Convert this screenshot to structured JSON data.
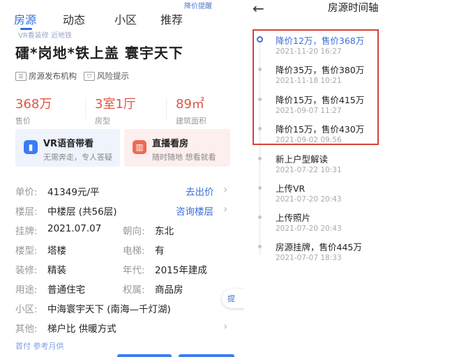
{
  "tabs": [
    "房源",
    "动态",
    "小区",
    "推荐"
  ],
  "cut_text": {
    "left": "VR看装修  近地铁",
    "right": "降价提醒"
  },
  "listing": {
    "title": "礌*岗地*铁上盖     寰宇天下"
  },
  "tags": [
    {
      "icon": "info-icon",
      "label": "房源发布机构"
    },
    {
      "icon": "shield-icon",
      "label": "风险提示"
    }
  ],
  "stats": [
    {
      "value": "368万",
      "label": "售价"
    },
    {
      "value": "3室1厅",
      "label": "房型"
    },
    {
      "value": "89㎡",
      "label": "建筑面积"
    }
  ],
  "cards": [
    {
      "icon": "vr-icon",
      "title": "VR语音带看",
      "subtitle": "无需奔走，专人答疑"
    },
    {
      "icon": "live-icon",
      "title": "直播看房",
      "subtitle": "随时随地 想看就看"
    }
  ],
  "info_rows": [
    {
      "k": "单价:",
      "v": "41349元/平",
      "link": "去出价"
    },
    {
      "k": "楼层:",
      "v": "中楼层 (共56层)",
      "link": "咨询楼层"
    },
    {
      "k": "挂牌:",
      "v": "2021.07.07",
      "k2": "朝向:",
      "v2": "东北"
    },
    {
      "k": "楼型:",
      "v": "塔楼",
      "k2": "电梯:",
      "v2": "有"
    },
    {
      "k": "装修:",
      "v": "精装",
      "k2": "年代:",
      "v2": "2015年建成"
    },
    {
      "k": "用途:",
      "v": "普通住宅",
      "k2": "权属:",
      "v2": "商品房"
    },
    {
      "k": "小区:",
      "v": "中海寰宇天下 (南海—千灯湖)"
    },
    {
      "k": "其他:",
      "v": "梯户比 供暖方式"
    }
  ],
  "float_button": "提",
  "cut_bottom": "首付 参考月供",
  "timeline": {
    "title": "房源时间轴",
    "items": [
      {
        "event": "降价12万，售价368万",
        "date": "2021-11-20 16:27",
        "active": true
      },
      {
        "event": "降价35万，售价380万",
        "date": "2021-11-18 10:21"
      },
      {
        "event": "降价15万，售价415万",
        "date": "2021-09-07 11:27"
      },
      {
        "event": "降价15万，售价430万",
        "date": "2021-09-02 09:56"
      },
      {
        "event": "新上户型解读",
        "date": "2021-07-22 10:31"
      },
      {
        "event": "上传VR",
        "date": "2021-07-20 20:43"
      },
      {
        "event": "上传照片",
        "date": "2021-07-20 20:43"
      },
      {
        "event": "房源挂牌，售价445万",
        "date": "2021-07-07 18:33"
      }
    ]
  }
}
